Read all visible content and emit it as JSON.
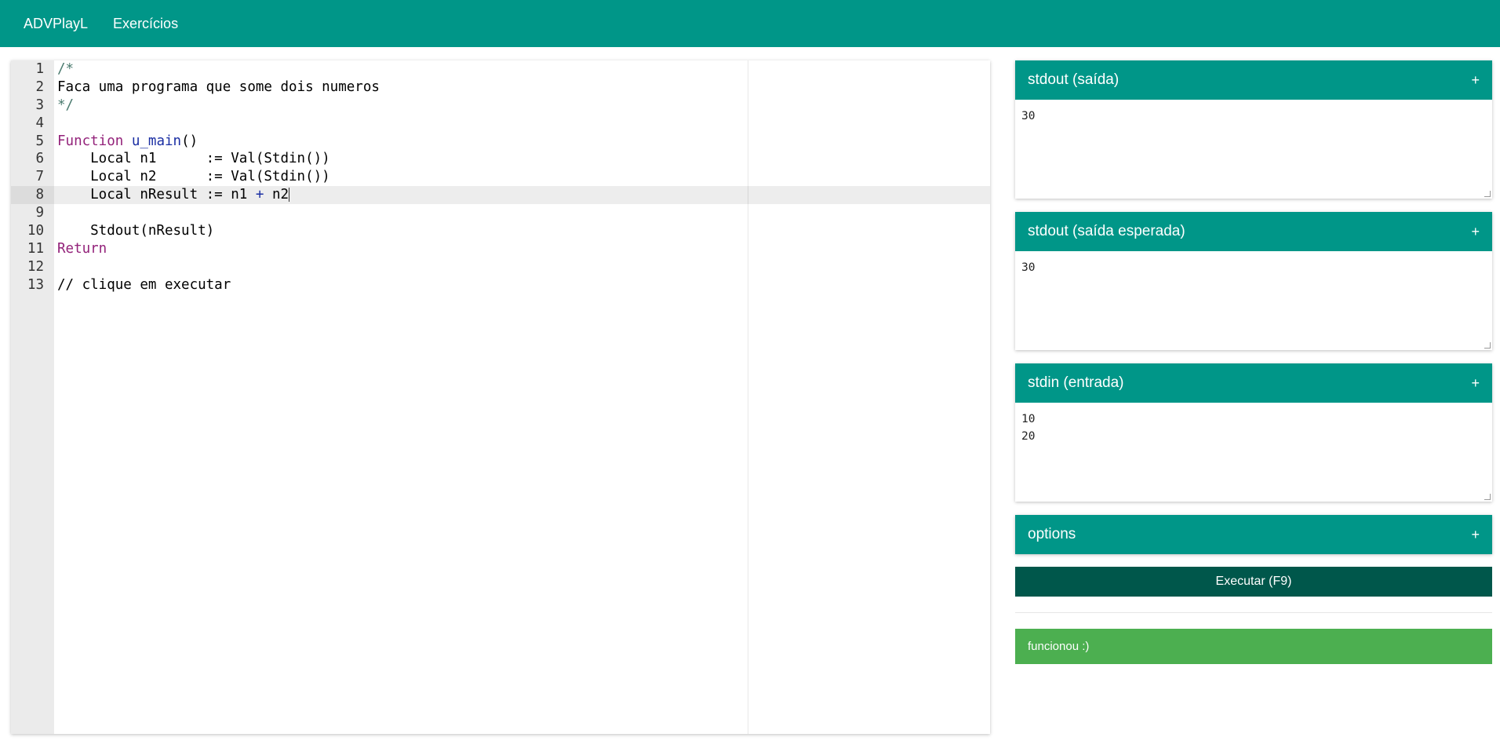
{
  "nav": {
    "brand": "ADVPlayL",
    "exercises": "Exercícios"
  },
  "editor": {
    "lines": [
      {
        "n": "1",
        "parts": [
          {
            "t": "/*",
            "c": "comment"
          }
        ]
      },
      {
        "n": "2",
        "parts": [
          {
            "t": "Faca uma programa que some dois numeros",
            "c": ""
          }
        ]
      },
      {
        "n": "3",
        "parts": [
          {
            "t": "*/",
            "c": "comment"
          }
        ]
      },
      {
        "n": "4",
        "parts": []
      },
      {
        "n": "5",
        "parts": [
          {
            "t": "Function",
            "c": "kw"
          },
          {
            "t": " ",
            "c": ""
          },
          {
            "t": "u_main",
            "c": "fn"
          },
          {
            "t": "()",
            "c": ""
          }
        ]
      },
      {
        "n": "6",
        "parts": [
          {
            "t": "    Local n1      := Val(Stdin())",
            "c": ""
          }
        ]
      },
      {
        "n": "7",
        "parts": [
          {
            "t": "    Local n2      := Val(Stdin())",
            "c": ""
          }
        ]
      },
      {
        "n": "8",
        "parts": [
          {
            "t": "    Local nResult := n1 ",
            "c": ""
          },
          {
            "t": "+",
            "c": "fn"
          },
          {
            "t": " n2",
            "c": ""
          }
        ],
        "active": true
      },
      {
        "n": "9",
        "parts": []
      },
      {
        "n": "10",
        "parts": [
          {
            "t": "    Stdout(nResult)",
            "c": ""
          }
        ]
      },
      {
        "n": "11",
        "parts": [
          {
            "t": "Return",
            "c": "kw"
          }
        ]
      },
      {
        "n": "12",
        "parts": []
      },
      {
        "n": "13",
        "parts": [
          {
            "t": "// clique em executar",
            "c": ""
          }
        ]
      }
    ]
  },
  "panels": {
    "stdout": {
      "title": "stdout (saída)",
      "toggle": "+",
      "value": "30"
    },
    "expected": {
      "title": "stdout (saída esperada)",
      "toggle": "+",
      "value": "30"
    },
    "stdin": {
      "title": "stdin (entrada)",
      "toggle": "+",
      "value": "10\n20"
    },
    "options": {
      "title": "options",
      "toggle": "+"
    }
  },
  "run_button": "Executar (F9)",
  "status": "funcionou :)",
  "colors": {
    "primary": "#009688",
    "primary_dark": "#00574b",
    "success": "#4caf50"
  }
}
